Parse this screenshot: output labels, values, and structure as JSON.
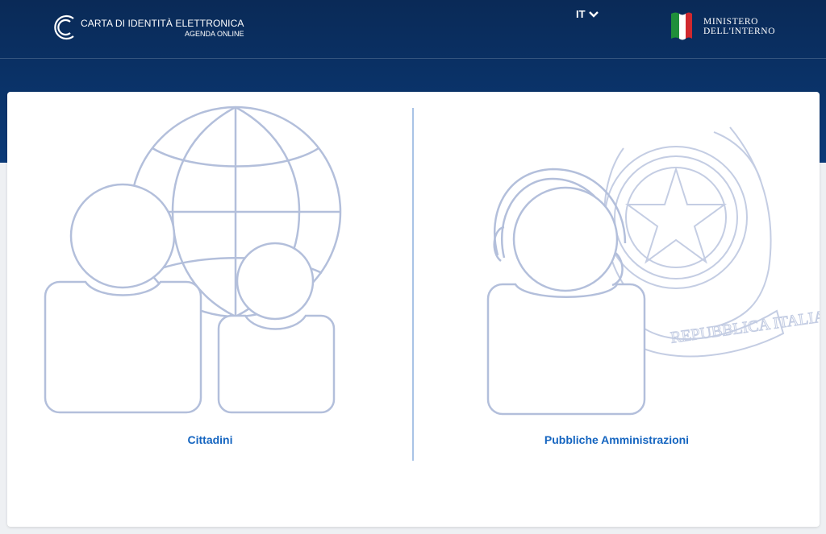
{
  "header": {
    "brand_title": "CARTA DI IDENTITÀ ELETTRONICA",
    "brand_subtitle": "AGENDA ONLINE",
    "language": "IT",
    "ministry_line1": "MINISTERO",
    "ministry_line2": "DELL'INTERNO"
  },
  "options": [
    {
      "label": "Cittadini",
      "icon": "citizens-globe-icon"
    },
    {
      "label": "Pubbliche Amministrazioni",
      "icon": "public-administration-icon"
    }
  ],
  "emblem_text": "REPUBBLICA ITALIANA",
  "colors": {
    "header_bg": "#0b3a78",
    "link": "#1565c0",
    "illustration_stroke": "#b3bfdb",
    "divider": "#a9c3e6"
  }
}
